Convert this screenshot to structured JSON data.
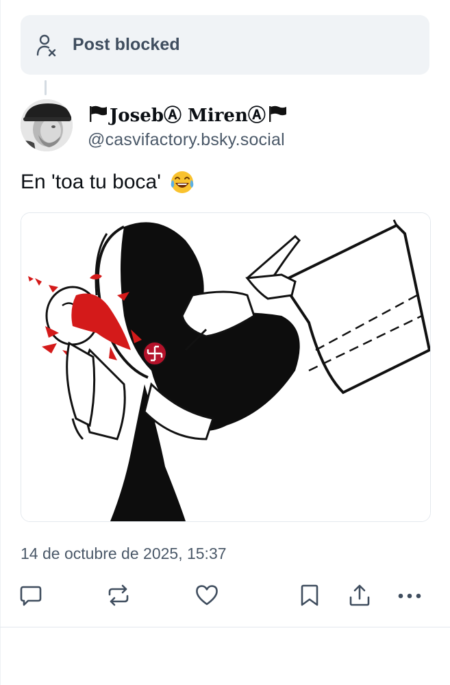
{
  "notice": {
    "label": "Post blocked",
    "icon": "person-x-icon"
  },
  "post": {
    "author": {
      "display_name_prefix_icon": "black-flag-icon",
      "display_name": "JosebⒶ MirenⒶ",
      "display_name_suffix_icon": "black-flag-icon",
      "handle": "@casvifactory.bsky.social",
      "avatar": "avatar"
    },
    "text": "En 'toa tu boca'",
    "emoji": "laughing-tears-emoji",
    "media": "cartoon-image",
    "timestamp": "14 de octubre de 2025, 15:37"
  },
  "actions": [
    {
      "name": "reply",
      "icon": "speech-bubble-icon"
    },
    {
      "name": "repost",
      "icon": "repost-icon"
    },
    {
      "name": "like",
      "icon": "heart-icon"
    },
    {
      "name": "bookmark",
      "icon": "bookmark-icon"
    },
    {
      "name": "share",
      "icon": "share-icon"
    },
    {
      "name": "more",
      "icon": "more-dots-icon"
    }
  ],
  "colors": {
    "notice_bg": "#f0f3f6",
    "muted_text": "#4a5868",
    "icon": "#3f4d5e",
    "divider": "#e3e8ed"
  }
}
